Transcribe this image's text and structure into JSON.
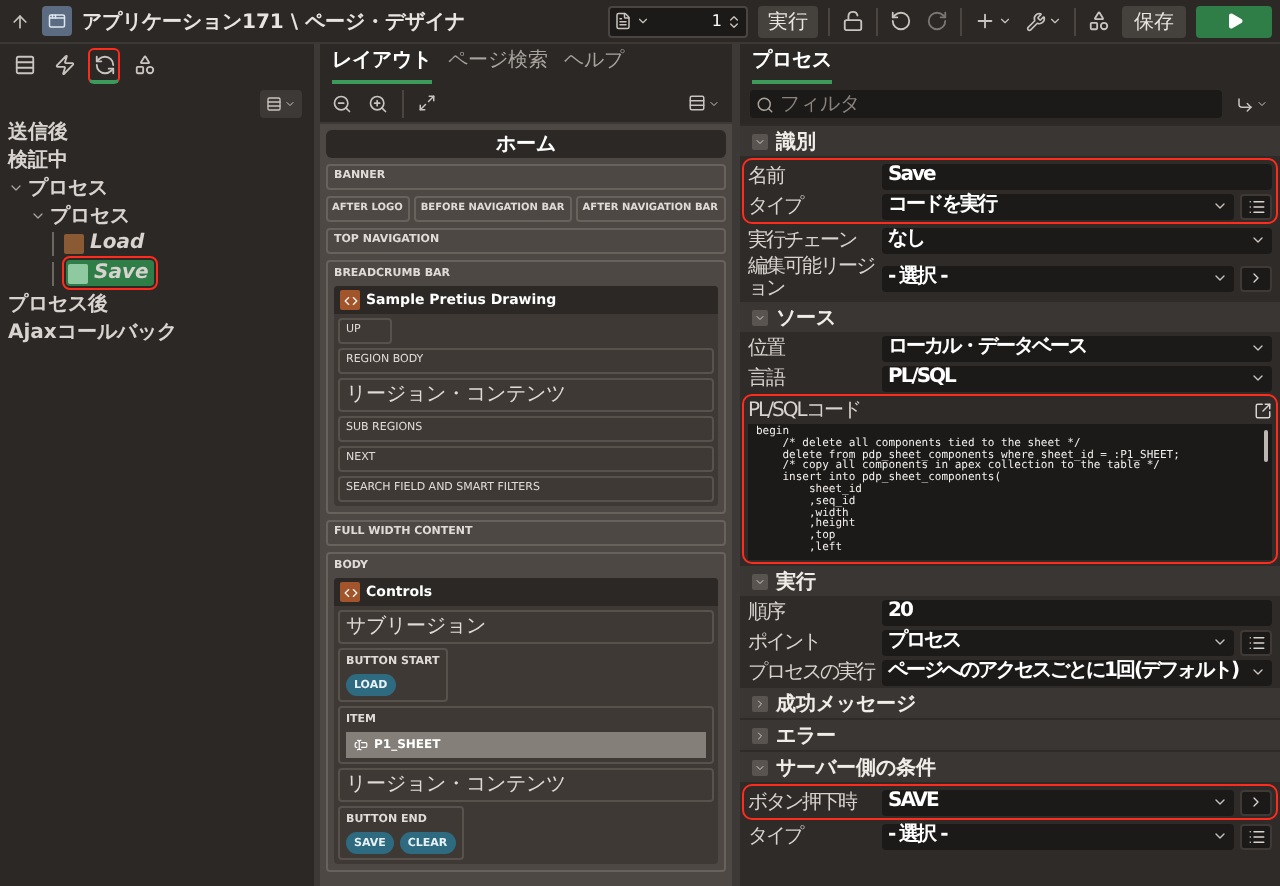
{
  "top_bar": {
    "breadcrumb": "アプリケーション171 \\ ページ・デザイナ",
    "page_number": "1",
    "run_label": "実行",
    "save_label": "保存"
  },
  "left_panel": {
    "tabs": [
      {
        "kind": "rendering",
        "selected": false,
        "highlighted": false
      },
      {
        "kind": "dynamic_actions",
        "selected": false,
        "highlighted": false
      },
      {
        "kind": "processing",
        "selected": true,
        "highlighted": true
      },
      {
        "kind": "shared",
        "selected": false,
        "highlighted": false
      }
    ],
    "tree": [
      {
        "label": "送信後",
        "kind": "point",
        "selected": false
      },
      {
        "label": "検証中",
        "kind": "point",
        "selected": false
      },
      {
        "label": "プロセス",
        "kind": "group",
        "selected": false,
        "expanded": true,
        "children": [
          {
            "label": "プロセス",
            "kind": "group",
            "selected": false,
            "expanded": true,
            "children": [
              {
                "label": "Load",
                "kind": "process",
                "selected": false,
                "highlighted": false
              },
              {
                "label": "Save",
                "kind": "process",
                "selected": true,
                "highlighted": true
              }
            ]
          }
        ]
      },
      {
        "label": "プロセス後",
        "kind": "point",
        "selected": false
      },
      {
        "label": "Ajaxコールバック",
        "kind": "point",
        "selected": false
      }
    ]
  },
  "middle_panel": {
    "tabs": [
      {
        "label": "レイアウト",
        "selected": true
      },
      {
        "label": "ページ検索",
        "selected": false
      },
      {
        "label": "ヘルプ",
        "selected": false
      }
    ],
    "page_title": "ホーム",
    "positions": [
      {
        "kind": "slot",
        "label": "BANNER"
      },
      {
        "kind": "row",
        "slots": [
          {
            "label": "AFTER LOGO"
          },
          {
            "label": "BEFORE NAVIGATION BAR"
          },
          {
            "label": "AFTER NAVIGATION BAR"
          }
        ]
      },
      {
        "kind": "slot",
        "label": "TOP NAVIGATION"
      },
      {
        "kind": "container",
        "label": "BREADCRUMB BAR",
        "region": {
          "title": "Sample Pretius Drawing",
          "slots": [
            {
              "kind": "small",
              "label": "UP"
            },
            {
              "kind": "slot",
              "label": "REGION BODY"
            },
            {
              "kind": "slot",
              "label": "リージョン・コンテンツ"
            },
            {
              "kind": "slot",
              "label": "SUB REGIONS"
            },
            {
              "kind": "slot",
              "label": "NEXT"
            },
            {
              "kind": "slot",
              "label": "SEARCH FIELD AND SMART FILTERS"
            }
          ]
        }
      },
      {
        "kind": "slot",
        "label": "FULL WIDTH CONTENT"
      },
      {
        "kind": "container",
        "label": "BODY",
        "region": {
          "title": "Controls",
          "slots": [
            {
              "kind": "slot",
              "label": "サブリージョン"
            },
            {
              "kind": "buttons",
              "label": "BUTTON START",
              "buttons": [
                "LOAD"
              ]
            },
            {
              "kind": "item",
              "label": "ITEM",
              "item": "P1_SHEET"
            },
            {
              "kind": "slot",
              "label": "リージョン・コンテンツ"
            },
            {
              "kind": "buttons",
              "label": "BUTTON END",
              "buttons": [
                "SAVE",
                "CLEAR"
              ]
            }
          ]
        }
      }
    ]
  },
  "right_panel": {
    "tabs": [
      {
        "label": "プロセス",
        "selected": true
      }
    ],
    "filter_placeholder": "フィルタ",
    "sections": [
      {
        "title": "識別",
        "expanded": true,
        "rows": [
          {
            "label": "名前",
            "kind": "text",
            "value": "Save",
            "highlighted": true
          },
          {
            "label": "タイプ",
            "kind": "select",
            "value": "コードを実行",
            "side": {
              "kind": "list"
            },
            "highlighted": true
          },
          {
            "label": "実行チェーン",
            "kind": "select",
            "value": "なし"
          },
          {
            "label": "編集可能リージョン",
            "kind": "select",
            "value": "- 選択 -",
            "side": {
              "kind": "arrow"
            }
          }
        ]
      },
      {
        "title": "ソース",
        "expanded": true,
        "rows": [
          {
            "label": "位置",
            "kind": "select",
            "value": "ローカル・データベース"
          },
          {
            "label": "言語",
            "kind": "select",
            "value": "PL/SQL"
          },
          {
            "label": "PL/SQLコード",
            "kind": "code",
            "highlighted": true,
            "lines": [
              "begin",
              "    /* delete all components tied to the sheet */",
              "    delete from pdp_sheet_components where sheet_id = :P1_SHEET;",
              "    /* copy all components in apex collection to the table */",
              "    insert into pdp_sheet_components(",
              "        sheet_id",
              "        ,seq_id",
              "        ,width",
              "        ,height",
              "        ,top",
              "        ,left"
            ]
          }
        ]
      },
      {
        "title": "実行",
        "expanded": true,
        "rows": [
          {
            "label": "順序",
            "kind": "text",
            "value": "20"
          },
          {
            "label": "ポイント",
            "kind": "select",
            "value": "プロセス",
            "side": {
              "kind": "list"
            }
          },
          {
            "label": "プロセスの実行",
            "kind": "select",
            "value": "ページへのアクセスごとに1回(デフォルト)"
          }
        ]
      },
      {
        "title": "成功メッセージ",
        "expanded": false
      },
      {
        "title": "エラー",
        "expanded": false
      },
      {
        "title": "サーバー側の条件",
        "expanded": true,
        "rows": [
          {
            "label": "ボタン押下時",
            "kind": "select",
            "value": "SAVE",
            "side": {
              "kind": "arrow"
            },
            "highlighted": true
          },
          {
            "label": "タイプ",
            "kind": "select",
            "value": "- 選択 -",
            "side": {
              "kind": "list"
            }
          }
        ]
      }
    ]
  }
}
